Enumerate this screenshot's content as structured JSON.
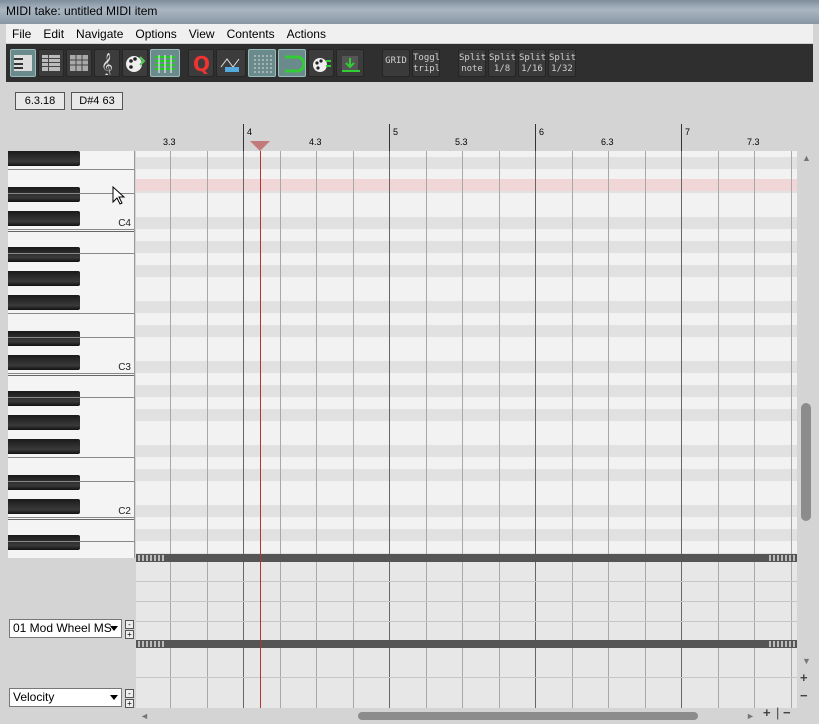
{
  "window": {
    "title": "MIDI take: untitled MIDI item"
  },
  "menu": [
    "File",
    "Edit",
    "Navigate",
    "Options",
    "View",
    "Contents",
    "Actions"
  ],
  "toolbar": {
    "icons": [
      "keyboard-icon",
      "named-notes-icon",
      "drum-grid-icon",
      "treble-clef-icon",
      "color-palette-icon",
      "grid-lines-icon",
      "quantize-icon",
      "envelope-icon",
      "snap-grid-icon",
      "loop-icon",
      "color-map-icon",
      "step-input-icon"
    ],
    "grid_label": "GRID",
    "toggle_line1": "Toggl",
    "toggle_line2": "tripl",
    "split_note_line1": "Split",
    "split_note_line2": "note",
    "split_8_line1": "Split",
    "split_8_line2": "1/8",
    "split_16_line1": "Split",
    "split_16_line2": "1/16",
    "split_32_line1": "Split",
    "split_32_line2": "1/32"
  },
  "info": {
    "position": "6.3.18",
    "note": "D#4  63"
  },
  "ruler": {
    "markers": [
      {
        "label": "3.3",
        "major": false
      },
      {
        "label": "4",
        "major": true
      },
      {
        "label": "4.3",
        "major": false
      },
      {
        "label": "5",
        "major": true
      },
      {
        "label": "5.3",
        "major": false
      },
      {
        "label": "6",
        "major": true
      },
      {
        "label": "6.3",
        "major": false
      },
      {
        "label": "7",
        "major": true
      },
      {
        "label": "7.3",
        "major": false
      }
    ]
  },
  "piano": {
    "c4_label": "C4",
    "c3_label": "C3",
    "c2_label": "C2"
  },
  "lanes": {
    "cc_lane_label": "01 Mod Wheel MS",
    "velocity_lane_label": "Velocity",
    "minus": "-",
    "plus": "+"
  },
  "scroll": {
    "zoom_in": "+",
    "zoom_out": "−",
    "sep": "|",
    "arrow_left": "◄",
    "arrow_right": "►",
    "arrow_up": "▲",
    "arrow_down": "▼"
  },
  "colors": {
    "playhead": "#b83030",
    "highlight_row": "#f0d6d6",
    "toolbar_bg": "#2f2f2f",
    "active_button": "#6a8a8c"
  }
}
